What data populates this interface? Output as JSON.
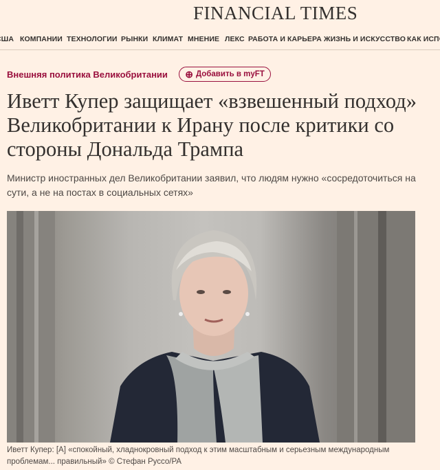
{
  "masthead": {
    "logo": "FINANCIAL TIMES"
  },
  "nav": {
    "items": [
      "США",
      "КОМПАНИИ",
      "ТЕХНОЛОГИИ",
      "РЫНКИ",
      "КЛИМАТ",
      "МНЕНИЕ",
      "ЛЕКС",
      "РАБОТА И КАРЬЕРА",
      "ЖИЗНЬ И ИСКУССТВО",
      "КАК ИСПОЛЬЗОВАТЬ"
    ]
  },
  "article": {
    "topic": "Внешняя политика Великобритании",
    "myft_label": "Добавить в myFT",
    "headline": "Иветт Купер защищает «взвешенный подход» Великобритании к Ирану после критики со стороны Дональда Трампа",
    "standfirst": "Министр иностранных дел Великобритании заявил, что людям нужно «сосредоточиться на сути, а не на постах в социальных сетях»",
    "caption": "Иветт Купер: [А] «спокойный, хладнокровный подход к этим масштабным и серьезным международным проблемам... правильный» © Стефан Руссо/PA"
  }
}
